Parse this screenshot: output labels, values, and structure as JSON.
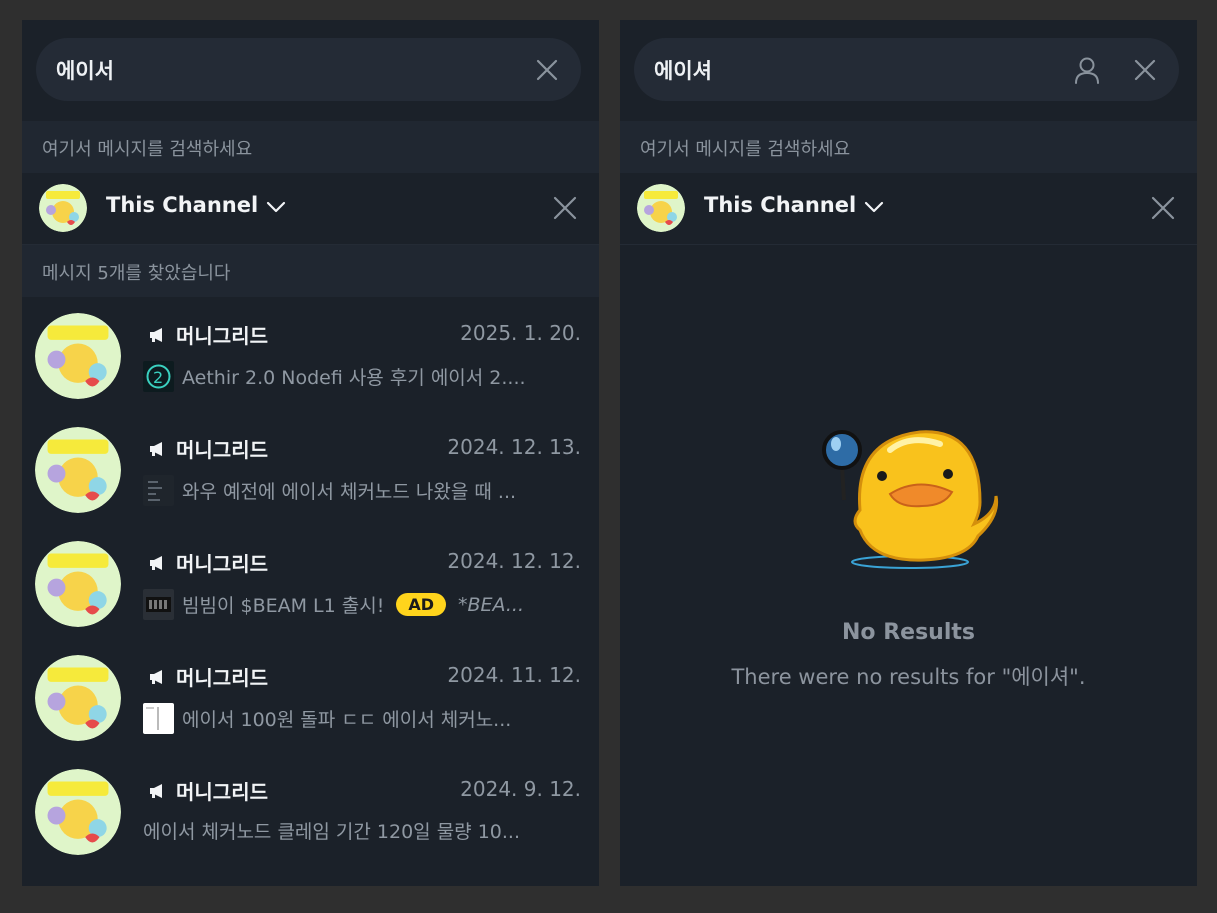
{
  "left_panel": {
    "search_query": "에이서",
    "hint": "여기서 메시지를 검색하세요",
    "scope_label": "This Channel",
    "found_text": "메시지 5개를 찾았습니다",
    "results": [
      {
        "channel": "머니그리드",
        "date": "2025. 1. 20.",
        "preview": "Aethir 2.0 Nodefi 사용 후기  에이서 2...."
      },
      {
        "channel": "머니그리드",
        "date": "2024. 12. 13.",
        "preview": "와우 예전에 에이서 체커노드 나왔을 때 ..."
      },
      {
        "channel": "머니그리드",
        "date": "2024. 12. 12.",
        "preview": "빔빔이 $BEAM L1 출시!",
        "badge": "AD",
        "more": "*BEA..."
      },
      {
        "channel": "머니그리드",
        "date": "2024. 11. 12.",
        "preview": "에이서 100원 돌파 ㄷㄷ  에이서 체커노..."
      },
      {
        "channel": "머니그리드",
        "date": "2024. 9. 12.",
        "preview": "에이서 체커노드 클레임 기간 120일 물량 10..."
      }
    ]
  },
  "right_panel": {
    "search_query": "에이셔",
    "hint": "여기서 메시지를 검색하세요",
    "scope_label": "This Channel",
    "empty_title": "No Results",
    "empty_subtitle": "There were no results for \"에이셔\"."
  },
  "icons": {
    "clear": "close-icon",
    "user": "user-icon",
    "chevron": "chevron-down-icon",
    "megaphone": "megaphone-icon"
  },
  "colors": {
    "background": "#2f2f2f",
    "panel": "#1b2129",
    "search_field": "#242b36",
    "section_bar": "#202731",
    "muted_text": "#8f98a2",
    "ad_badge": "#ffd41c"
  }
}
